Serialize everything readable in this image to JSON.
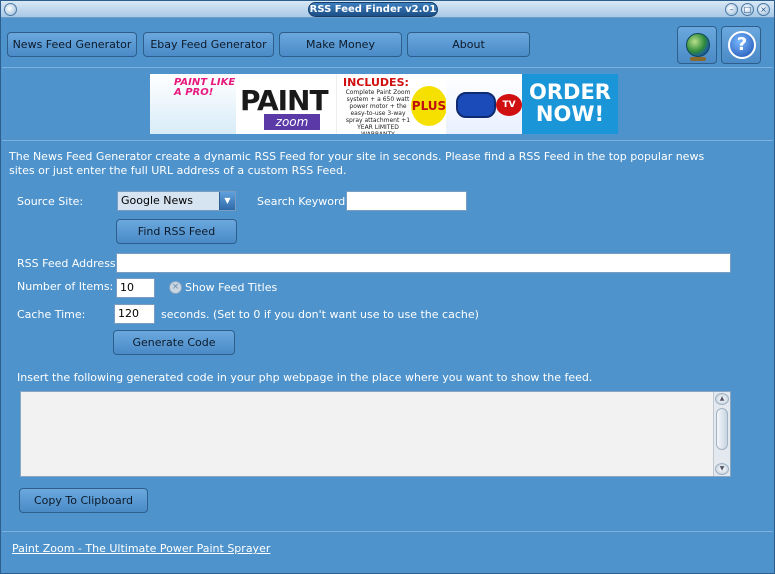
{
  "window": {
    "title": "RSS Feed Finder v2.01",
    "buttons": {
      "minimize": "–",
      "maximize": "□",
      "close": "×"
    }
  },
  "tabs": [
    {
      "label": "News Feed Generator"
    },
    {
      "label": "Ebay Feed Generator"
    },
    {
      "label": "Make Money"
    },
    {
      "label": "About"
    }
  ],
  "icons": {
    "globe": "globe-icon",
    "help": "help-icon",
    "help_glyph": "?"
  },
  "banner": {
    "tagline": "PAINT LIKE A PRO!",
    "brand": "PAINT",
    "brand_sub": "zoom",
    "includes_title": "INCLUDES:",
    "includes_text": "Complete Paint Zoom system + a 650 watt power motor + the easy-to-use 3-way spray attachment +1 YEAR LIMITED WARRANTY",
    "plus_badge": "PLUS $25",
    "plus_sub": "in FREE bonuses",
    "tv_badge": "TV",
    "cta": "ORDER NOW!"
  },
  "description": "The News Feed Generator create a dynamic RSS Feed for your site in seconds. Please find a RSS Feed in the top popular news sites or just enter the full URL address of a custom RSS Feed.",
  "form": {
    "source_site_label": "Source Site:",
    "source_site_value": "Google News",
    "search_keyword_label": "Search Keyword:",
    "search_keyword_value": "",
    "find_button": "Find RSS Feed",
    "rss_address_label": "RSS Feed Address:",
    "rss_address_value": "",
    "num_items_label": "Number of Items:",
    "num_items_value": "10",
    "show_titles_label": "Show Feed Titles",
    "show_titles_checked": false,
    "cache_label": "Cache Time:",
    "cache_value": "120",
    "cache_hint": "seconds. (Set to 0 if you don't want use to use the cache)",
    "generate_button": "Generate Code"
  },
  "output": {
    "instruction": "Insert the following generated code in your php webpage in the place where you want to show the feed.",
    "code": "",
    "copy_button": "Copy To Clipboard"
  },
  "footer": {
    "link": "Paint Zoom - The Ultimate Power Paint Sprayer"
  }
}
